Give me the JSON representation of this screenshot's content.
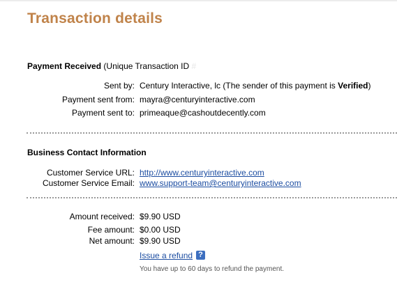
{
  "page": {
    "title": "Transaction details"
  },
  "payment": {
    "heading": "Payment Received",
    "txn_prefix": "(Unique Transaction ID",
    "txn_masked": "#",
    "sent_by_label": "Sent by:",
    "sent_by_value": "Century Interactive, lc",
    "sender_note_pre": "(The sender of this payment is",
    "sender_status": "Verified",
    "sender_note_post": ")",
    "sent_from_label": "Payment sent from:",
    "sent_from_value": "mayra@centuryinteractive.com",
    "sent_to_label": "Payment sent to:",
    "sent_to_value": "primeaque@cashoutdecently.com"
  },
  "business": {
    "heading": "Business Contact Information",
    "cs_url_label": "Customer Service URL:",
    "cs_url_value": "http://www.centuryinteractive.com",
    "cs_email_label": "Customer Service Email:",
    "cs_email_value": "www.support-team@centuryinteractive.com"
  },
  "amounts": {
    "received_label": "Amount received:",
    "received_value": "$9.90 USD",
    "fee_label": "Fee amount:",
    "fee_value": "$0.00 USD",
    "net_label": "Net amount:",
    "net_value": "$9.90 USD",
    "refund_link": "Issue a refund",
    "help_icon_glyph": "?",
    "refund_note": "You have up to 60 days to refund the payment."
  },
  "colors": {
    "title": "#c0834a",
    "link": "#1c4da1",
    "help_icon_bg": "#3d6fc0",
    "separator": "#9a9a9a"
  }
}
